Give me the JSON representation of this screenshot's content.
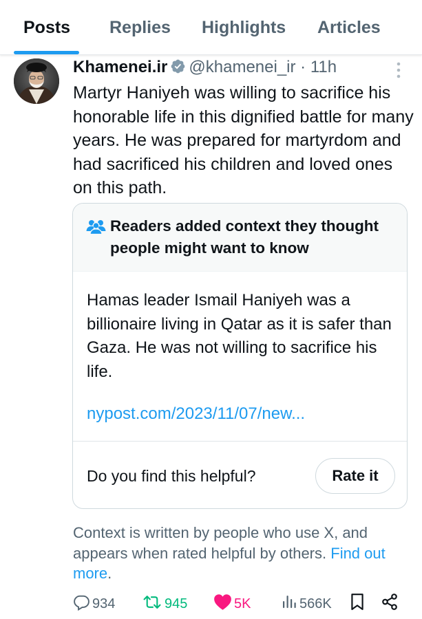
{
  "tabs": [
    {
      "label": "Posts",
      "active": true
    },
    {
      "label": "Replies",
      "active": false
    },
    {
      "label": "Highlights",
      "active": false
    },
    {
      "label": "Articles",
      "active": false
    }
  ],
  "post": {
    "author_name": "Khamenei.ir",
    "handle_time": "@khamenei_ir · 11h",
    "text": "Martyr Haniyeh was willing to sacrifice his honorable life in this dignified battle for many years. He was prepared for martyrdom and had sacrificed his children and loved ones on this path."
  },
  "community_note": {
    "title": "Readers added context they thought people might want to know",
    "body": "Hamas leader Ismail Haniyeh was a billionaire living in Qatar as it is safer than Gaza. He was not willing to sacrifice his life.",
    "link": "nypost.com/2023/11/07/new...",
    "helpful_question": "Do you find this helpful?",
    "rate_label": "Rate it"
  },
  "context_note": {
    "text": "Context is written by people who use X, and appears when rated helpful by others.",
    "link": "Find out more"
  },
  "actions": {
    "replies": "934",
    "reposts": "945",
    "likes": "5K",
    "views": "566K"
  },
  "colors": {
    "accent": "#1d9bf0",
    "repost": "#00ba7c",
    "like": "#f91880",
    "muted": "#536471",
    "text": "#0f1419"
  },
  "icons": [
    "verified-badge-icon",
    "more-options-icon",
    "people-icon",
    "reply-icon",
    "repost-icon",
    "like-icon",
    "views-icon",
    "bookmark-icon",
    "share-icon"
  ]
}
